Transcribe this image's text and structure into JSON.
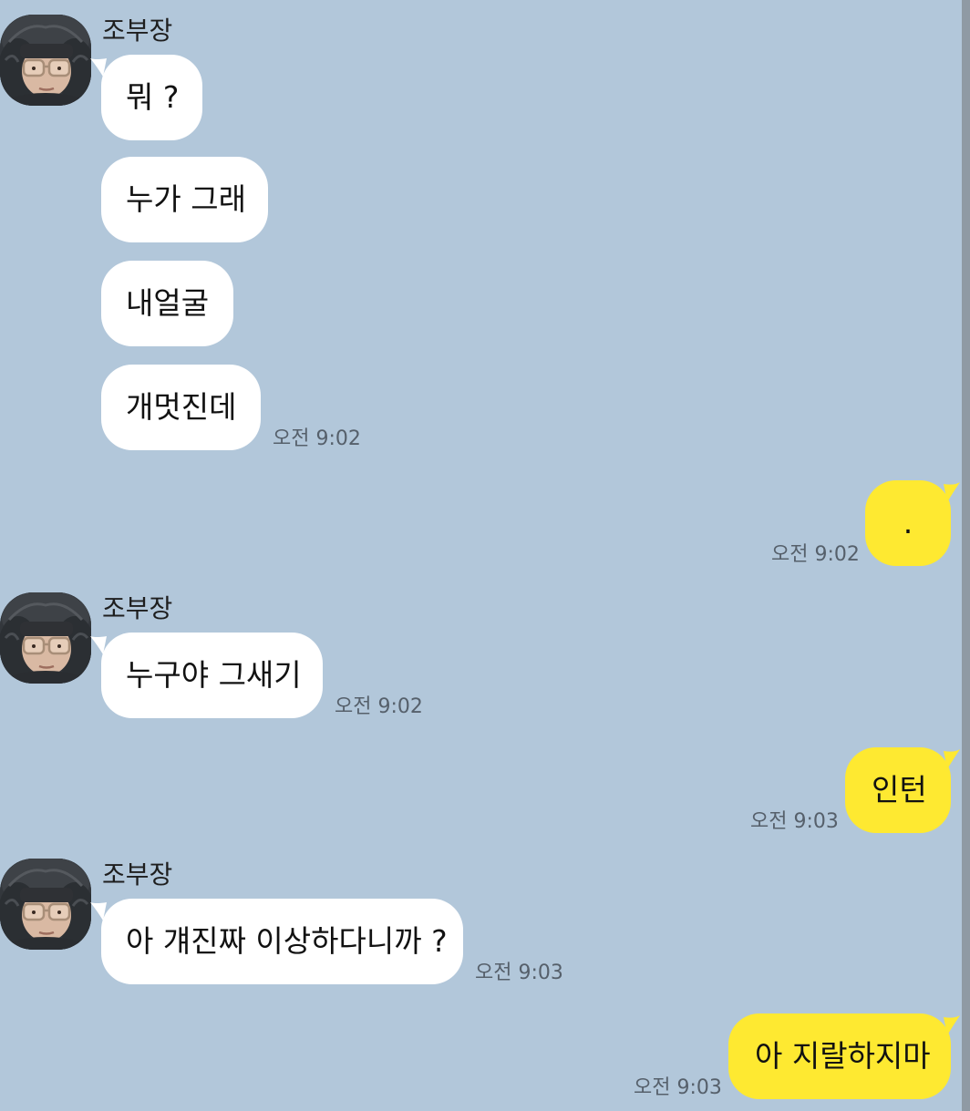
{
  "colors": {
    "background": "#b2c7da",
    "received_bubble": "#ffffff",
    "sent_bubble": "#fee931",
    "timestamp": "#56606b"
  },
  "messages": [
    {
      "direction": "received",
      "sender": "조부장",
      "avatar_icon": "profile-photo-avatar",
      "lines": [
        "뭐 ?",
        "누가 그래",
        "내얼굴",
        "개멋진데"
      ],
      "time": "오전 9:02"
    },
    {
      "direction": "sent",
      "lines": [
        "."
      ],
      "time": "오전 9:02"
    },
    {
      "direction": "received",
      "sender": "조부장",
      "avatar_icon": "profile-photo-avatar",
      "lines": [
        "누구야 그새기"
      ],
      "time": "오전 9:02"
    },
    {
      "direction": "sent",
      "lines": [
        "인턴"
      ],
      "time": "오전 9:03"
    },
    {
      "direction": "received",
      "sender": "조부장",
      "avatar_icon": "profile-photo-avatar",
      "lines": [
        "아 걔진짜 이상하다니까 ?"
      ],
      "time": "오전 9:03"
    },
    {
      "direction": "sent",
      "lines": [
        "아 지랄하지마"
      ],
      "time": "오전 9:03"
    }
  ]
}
